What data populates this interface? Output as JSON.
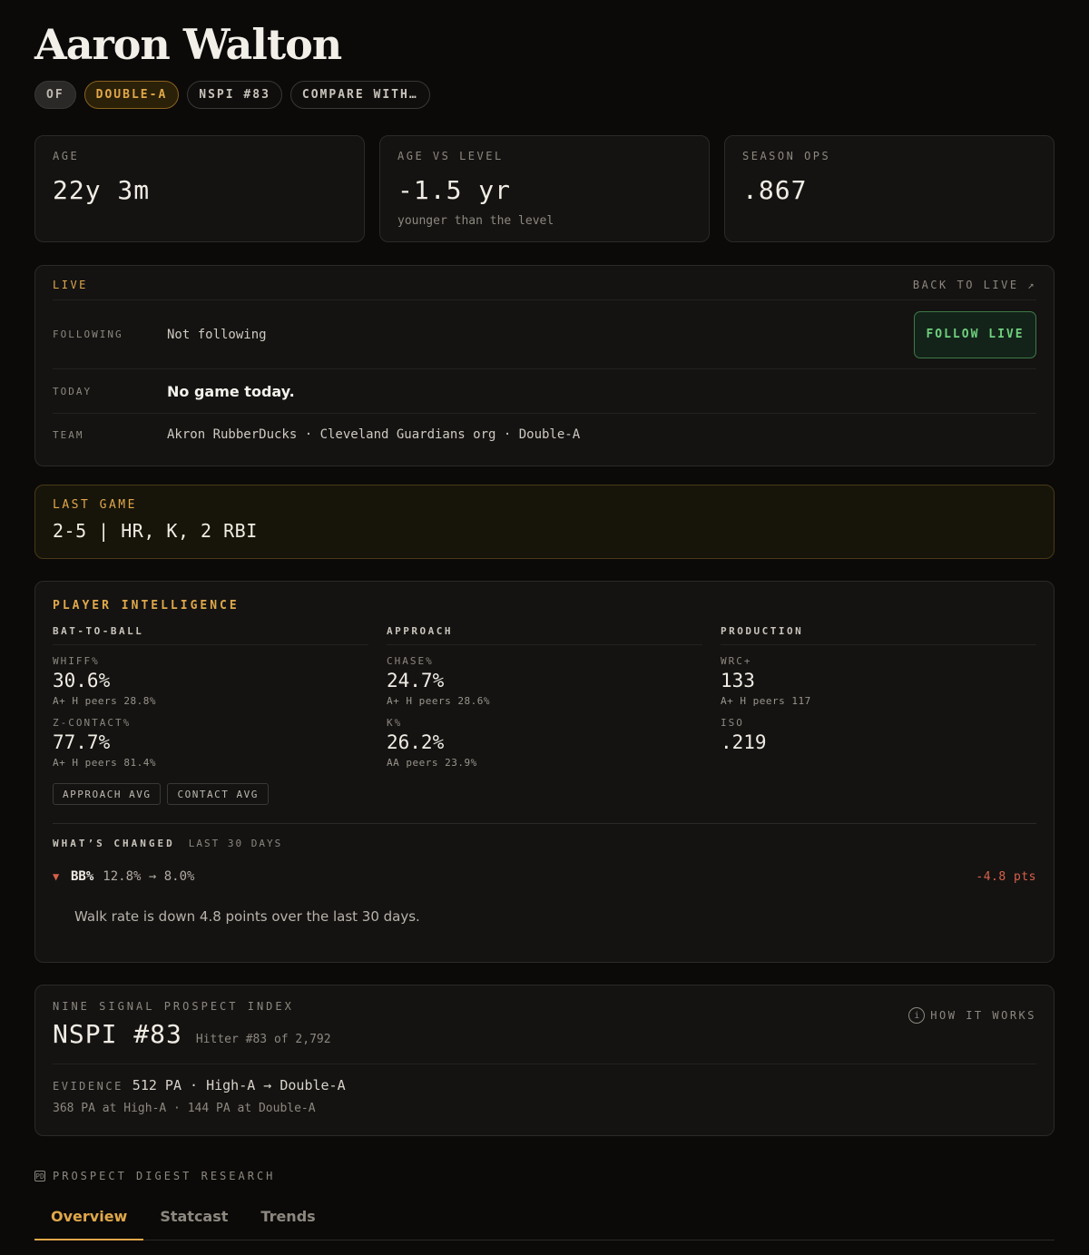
{
  "player": {
    "name": "Aaron Walton"
  },
  "tags": {
    "position": "OF",
    "level": "DOUBLE-A",
    "rank": "NSPI #83",
    "compare": "COMPARE WITH…"
  },
  "cards": [
    {
      "label": "AGE",
      "value": "22y 3m",
      "sub": ""
    },
    {
      "label": "AGE VS LEVEL",
      "value": "-1.5 yr",
      "sub": "younger than the level"
    },
    {
      "label": "SEASON OPS",
      "value": ".867",
      "sub": ""
    }
  ],
  "live": {
    "title": "LIVE",
    "back_link": "BACK TO LIVE ↗",
    "following_label": "FOLLOWING",
    "following_value": "Not following",
    "follow_button": "FOLLOW LIVE",
    "today_label": "TODAY",
    "today_value": "No game today.",
    "team_label": "TEAM",
    "team_value": "Akron RubberDucks · Cleveland Guardians org · Double-A"
  },
  "last_game": {
    "label": "LAST GAME",
    "value": "2-5 | HR, K, 2 RBI"
  },
  "intelligence": {
    "title": "PLAYER INTELLIGENCE",
    "columns": [
      {
        "head": "BAT-TO-BALL",
        "metrics": [
          {
            "label": "WHIFF%",
            "value": "30.6%",
            "peer": "A+ H peers 28.8%"
          },
          {
            "label": "Z-CONTACT%",
            "value": "77.7%",
            "peer": "A+ H peers 81.4%"
          }
        ]
      },
      {
        "head": "APPROACH",
        "metrics": [
          {
            "label": "CHASE%",
            "value": "24.7%",
            "peer": "A+ H peers 28.6%"
          },
          {
            "label": "K%",
            "value": "26.2%",
            "peer": "AA peers 23.9%"
          }
        ]
      },
      {
        "head": "PRODUCTION",
        "metrics": [
          {
            "label": "WRC+",
            "value": "133",
            "peer": "A+ H peers 117"
          },
          {
            "label": "ISO",
            "value": ".219",
            "peer": ""
          }
        ]
      }
    ],
    "chips": [
      "APPROACH AVG",
      "CONTACT AVG"
    ],
    "changed": {
      "title": "WHAT’S CHANGED",
      "period": "LAST 30 DAYS",
      "stat": "BB%",
      "range": "12.8% → 8.0%",
      "delta": "-4.8 pts",
      "note": "Walk rate is down 4.8 points over the last 30 days."
    }
  },
  "nspi": {
    "label": "NINE SIGNAL PROSPECT INDEX",
    "rank": "NSPI #83",
    "sub": "Hitter #83 of 2,792",
    "how": "HOW IT WORKS",
    "how_icon": "i",
    "evidence_label": "EVIDENCE",
    "evidence_value": "512 PA · High-A → Double-A",
    "evidence_detail": "368 PA at High-A · 144 PA at Double-A"
  },
  "research": {
    "label": "PROSPECT DIGEST RESEARCH",
    "icon": "PD"
  },
  "tabs": [
    "Overview",
    "Statcast",
    "Trends"
  ],
  "colors": {
    "accent": "#e0a84a",
    "positive": "#6fd07c",
    "negative": "#d9604a",
    "background": "#0b0a09"
  }
}
